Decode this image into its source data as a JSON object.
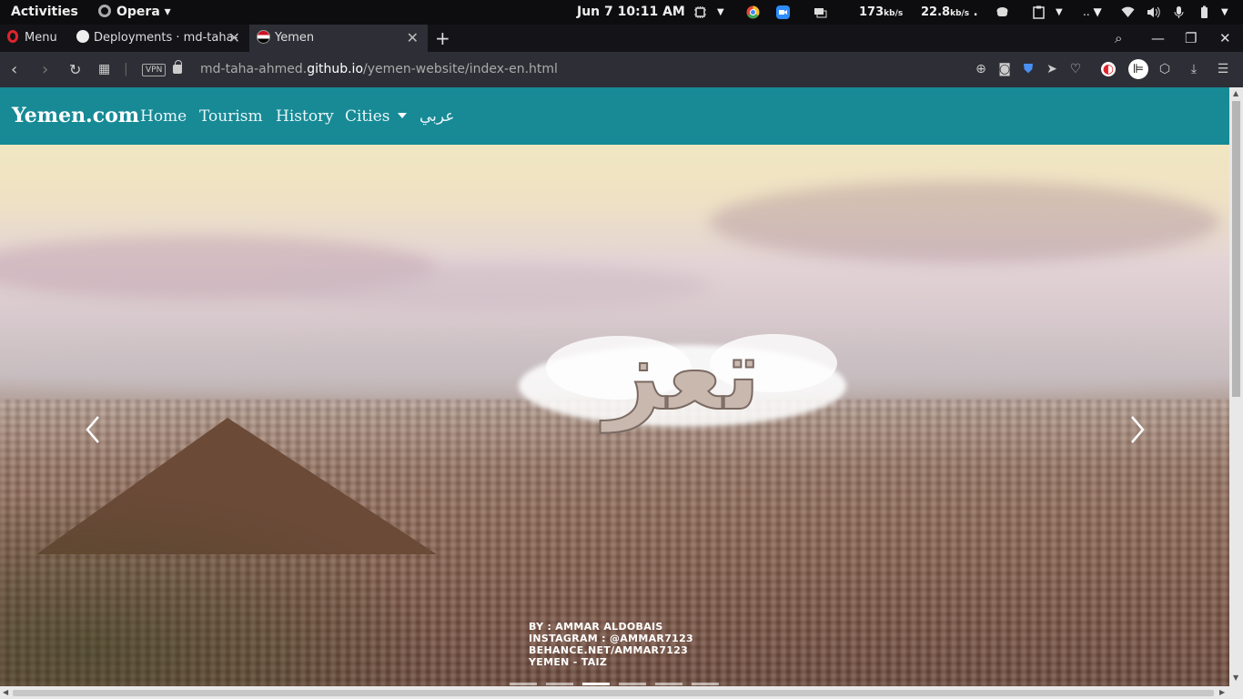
{
  "system_bar": {
    "activities": "Activities",
    "app_name": "Opera",
    "clock": "Jun 7  10:11 AM",
    "net_down": "173",
    "net_down_unit": "kb/s",
    "net_up": "22.8",
    "net_up_unit": "kb/s",
    "icons": [
      "cpu-icon",
      "chrome-icon",
      "zoom-icon",
      "display-icon",
      "coffee-icon",
      "clipboard-icon",
      "wifi-icon",
      "volume-icon",
      "mic-icon",
      "battery-icon"
    ]
  },
  "browser": {
    "menu_label": "Menu",
    "tabs": [
      {
        "title": "Deployments · md-taha-",
        "icon": "github-icon",
        "active": false
      },
      {
        "title": "Yemen",
        "icon": "yemen-flag-icon",
        "active": true
      }
    ],
    "vpn_label": "VPN",
    "url_prefix": "md-taha-ahmed.",
    "url_domain": "github.io",
    "url_path": "/yemen-website/index-en.html"
  },
  "site": {
    "brand": "Yemen.com",
    "nav": [
      {
        "label": "Home"
      },
      {
        "label": "Tourism"
      },
      {
        "label": "History"
      },
      {
        "label": "Cities",
        "dropdown": true
      },
      {
        "label": "عربي"
      }
    ],
    "hero": {
      "image_title": "تعز",
      "credits": [
        "BY : AMMAR ALDOBAIS",
        "INSTAGRAM : @AMMAR7123",
        "BEHANCE.NET/AMMAR7123",
        "YEMEN - TAIZ"
      ],
      "slide_count": 6,
      "active_slide": 3
    }
  },
  "colors": {
    "navbar": "#178a96",
    "tab_active": "#2e2e36",
    "opera_red": "#e0242c"
  }
}
